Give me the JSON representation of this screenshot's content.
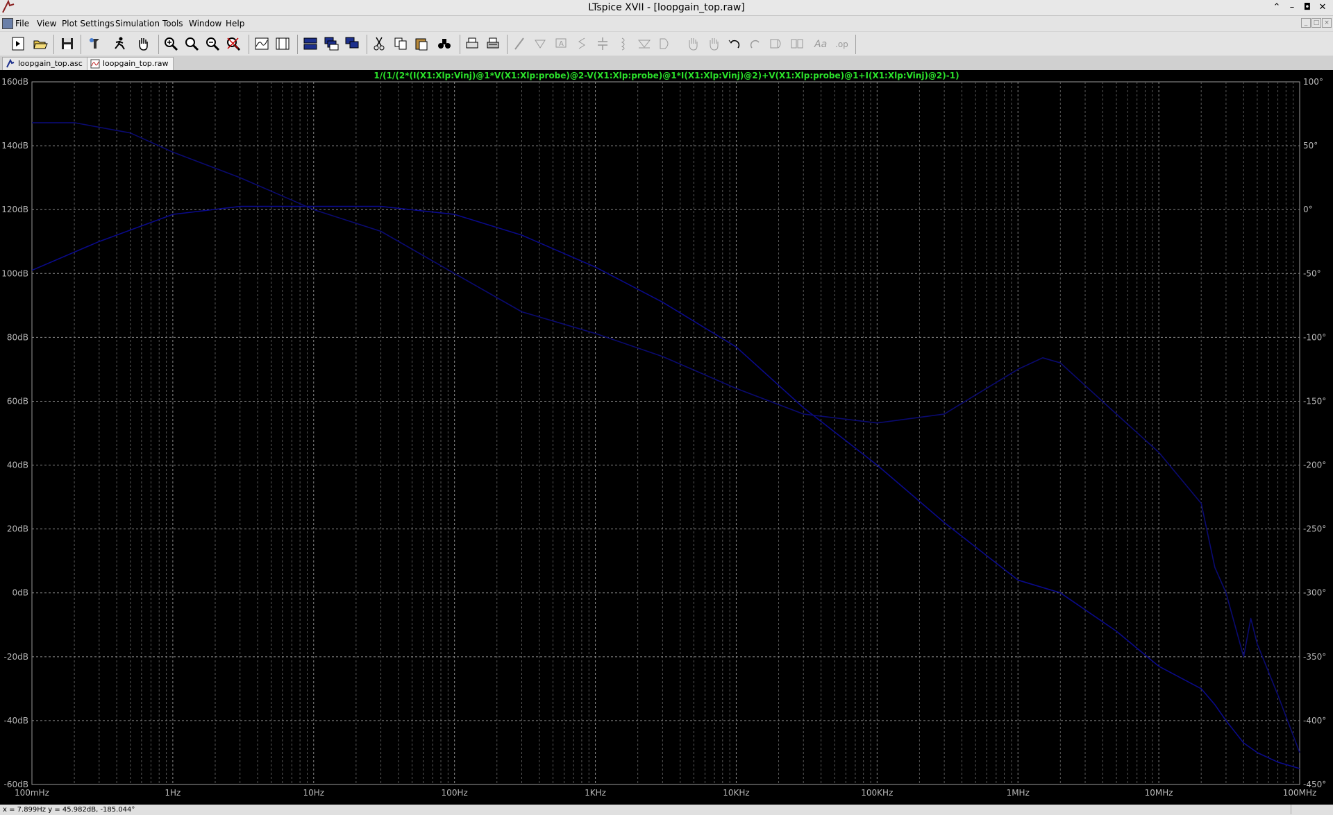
{
  "window": {
    "title": "LTspice XVII - [loopgain_top.raw]"
  },
  "menu": {
    "items": [
      {
        "label": "File",
        "name": "menu-file"
      },
      {
        "label": "View",
        "name": "menu-view"
      },
      {
        "label": "Plot Settings",
        "name": "menu-plot-settings"
      },
      {
        "label": "Simulation",
        "name": "menu-simulation"
      },
      {
        "label": "Tools",
        "name": "menu-tools"
      },
      {
        "label": "Window",
        "name": "menu-window"
      },
      {
        "label": "Help",
        "name": "menu-help"
      }
    ]
  },
  "toolbar": {
    "buttons": [
      "new-schematic-icon",
      "open-icon",
      "save-icon",
      "control-panel-icon",
      "run-icon",
      "pan-icon",
      "zoom-in-icon",
      "zoom-box-icon",
      "zoom-out-icon",
      "zoom-fit-icon",
      "autorange-icon",
      "mark-icon",
      "tile-horizontal-icon",
      "cascade-icon",
      "tile-vertical-icon",
      "cut-icon",
      "copy-icon",
      "paste-icon",
      "find-icon",
      "print-icon",
      "print-setup-icon",
      "wire-icon",
      "ground-icon",
      "label-net-icon",
      "resistor-icon",
      "capacitor-icon",
      "inductor-icon",
      "diode-icon",
      "component-icon",
      "move-icon",
      "drag-icon",
      "undo-icon",
      "redo-icon",
      "rotate-icon",
      "mirror-icon",
      "text-icon",
      "spice-directive-icon"
    ]
  },
  "tabs": [
    {
      "label": "loopgain_top.asc",
      "icon": "schematic-icon"
    },
    {
      "label": "loopgain_top.raw",
      "icon": "waveform-icon"
    }
  ],
  "plot": {
    "expression": "1/(1/(2*(I(X1:Xlp:Vinj)@1*V(X1:Xlp:probe)@2-V(X1:Xlp:probe)@1*I(X1:Xlp:Vinj)@2)+V(X1:Xlp:probe)@1+I(X1:Xlp:Vinj)@2)-1)",
    "expression_color": "#2be02b",
    "trace_color": "#0a0a8a",
    "phase_color": "#0a0a70"
  },
  "status": {
    "cursor": "x = 7.899Hz    y = 45.982dB, -185.044°"
  },
  "chart_data": {
    "type": "line",
    "title": "1/(1/(2*(I(X1:Xlp:Vinj)@1*V(X1:Xlp:probe)@2-V(X1:Xlp:probe)@1*I(X1:Xlp:Vinj)@2)+V(X1:Xlp:probe)@1+I(X1:Xlp:Vinj)@2)-1)",
    "x_scale": "log",
    "xlim": [
      0.1,
      100000000
    ],
    "x_tick_values": [
      0.1,
      1,
      10,
      100,
      1000,
      10000,
      100000,
      1000000,
      10000000,
      100000000
    ],
    "x_tick_labels": [
      "100mHz",
      "1Hz",
      "10Hz",
      "100Hz",
      "1KHz",
      "10KHz",
      "100KHz",
      "1MHz",
      "10MHz",
      "100MHz"
    ],
    "ylim_left": [
      -60,
      160
    ],
    "y_left_tick_values": [
      160,
      140,
      120,
      100,
      80,
      60,
      40,
      20,
      0,
      -20,
      -40,
      -60
    ],
    "y_left_tick_labels": [
      "160dB",
      "140dB",
      "120dB",
      "100dB",
      "80dB",
      "60dB",
      "40dB",
      "20dB",
      "0dB",
      "-20dB",
      "-40dB",
      "-60dB"
    ],
    "ylim_right": [
      -450,
      100
    ],
    "y_right_tick_values": [
      100,
      50,
      0,
      -50,
      -100,
      -150,
      -200,
      -250,
      -300,
      -350,
      -400,
      -450
    ],
    "y_right_tick_labels": [
      "100°",
      "50°",
      "0°",
      "-50°",
      "-100°",
      "-150°",
      "-200°",
      "-250°",
      "-300°",
      "-350°",
      "-400°",
      "-450°"
    ],
    "grid": true,
    "series": [
      {
        "axis": "left",
        "values": [
          [
            0.1,
            101
          ],
          [
            0.3,
            110
          ],
          [
            1,
            118.5
          ],
          [
            3,
            121
          ],
          [
            10,
            121
          ],
          [
            30,
            121
          ],
          [
            100,
            118.5
          ],
          [
            300,
            112
          ],
          [
            1000,
            102
          ],
          [
            3000,
            91
          ],
          [
            10000,
            77
          ],
          [
            30000,
            58
          ],
          [
            100000,
            40
          ],
          [
            300000,
            22
          ],
          [
            1000000,
            4
          ],
          [
            2000000,
            0
          ],
          [
            5000000,
            -12
          ],
          [
            10000000,
            -23
          ],
          [
            20000000,
            -30
          ],
          [
            25000000,
            -35
          ],
          [
            30000000,
            -40
          ],
          [
            40000000,
            -47
          ],
          [
            50000000,
            -50
          ],
          [
            70000000,
            -53
          ],
          [
            100000000,
            -55
          ]
        ]
      },
      {
        "axis": "right",
        "values": [
          [
            0.1,
            68
          ],
          [
            0.2,
            68
          ],
          [
            0.5,
            60
          ],
          [
            1,
            45
          ],
          [
            3,
            25
          ],
          [
            10,
            0
          ],
          [
            30,
            -17
          ],
          [
            100,
            -50
          ],
          [
            300,
            -80
          ],
          [
            1000,
            -97
          ],
          [
            3000,
            -115
          ],
          [
            10000,
            -140
          ],
          [
            30000,
            -160
          ],
          [
            100000,
            -167
          ],
          [
            300000,
            -160
          ],
          [
            1000000,
            -125
          ],
          [
            1500000,
            -116
          ],
          [
            2000000,
            -120
          ],
          [
            5000000,
            -160
          ],
          [
            10000000,
            -190
          ],
          [
            20000000,
            -230
          ],
          [
            25000000,
            -280
          ],
          [
            30000000,
            -300
          ],
          [
            40000000,
            -350
          ],
          [
            45000000,
            -320
          ],
          [
            50000000,
            -340
          ],
          [
            70000000,
            -380
          ],
          [
            100000000,
            -425
          ]
        ]
      }
    ]
  }
}
